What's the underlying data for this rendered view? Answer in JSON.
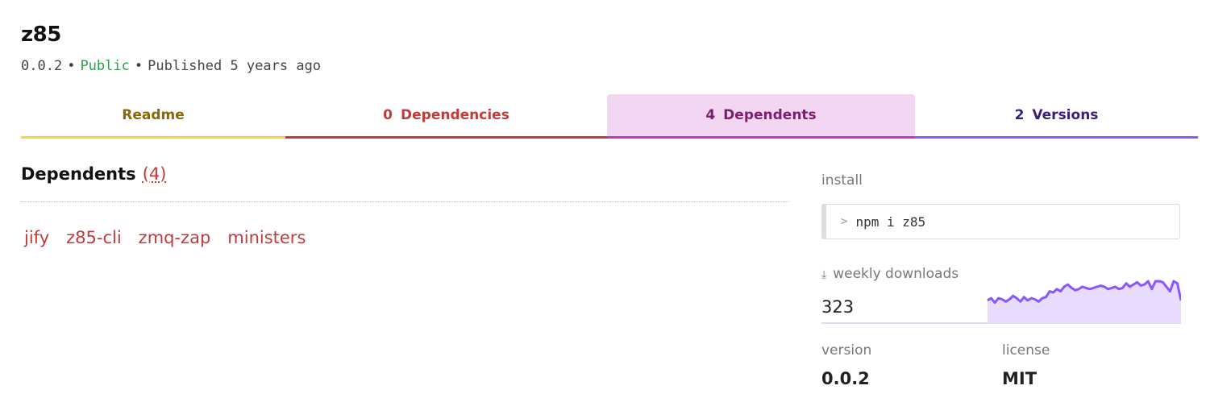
{
  "package": {
    "name": "z85",
    "version": "0.0.2",
    "visibility": "Public",
    "separator": "•",
    "published": "Published 5 years ago"
  },
  "tabs": [
    {
      "label": "Readme"
    },
    {
      "count": "0",
      "label": "Dependencies"
    },
    {
      "count": "4",
      "label": "Dependents"
    },
    {
      "count": "2",
      "label": "Versions"
    }
  ],
  "dependents": {
    "heading": "Dependents",
    "count": "(4)",
    "items": [
      "jify",
      "z85-cli",
      "zmq-zap",
      "ministers"
    ]
  },
  "sidebar": {
    "install_label": "install",
    "install_prompt": ">",
    "install_command": "npm i z85",
    "downloads_icon": "download-icon",
    "downloads_label": "weekly downloads",
    "downloads_value": "323",
    "downloads_trend": [
      10,
      12,
      8,
      12,
      11,
      9,
      11,
      14,
      12,
      9,
      13,
      10,
      12,
      11,
      9,
      12,
      13,
      18,
      17,
      20,
      18,
      22,
      24,
      21,
      19,
      20,
      22,
      21,
      20,
      21,
      22,
      23,
      22,
      20,
      21,
      22,
      20,
      21,
      25,
      22,
      24,
      26,
      23,
      24,
      28,
      20,
      27,
      30,
      26,
      22,
      18,
      35,
      25,
      10
    ],
    "accent_color": "#8956ff",
    "version_label": "version",
    "version_value": "0.0.2",
    "license_label": "license",
    "license_value": "MIT"
  }
}
